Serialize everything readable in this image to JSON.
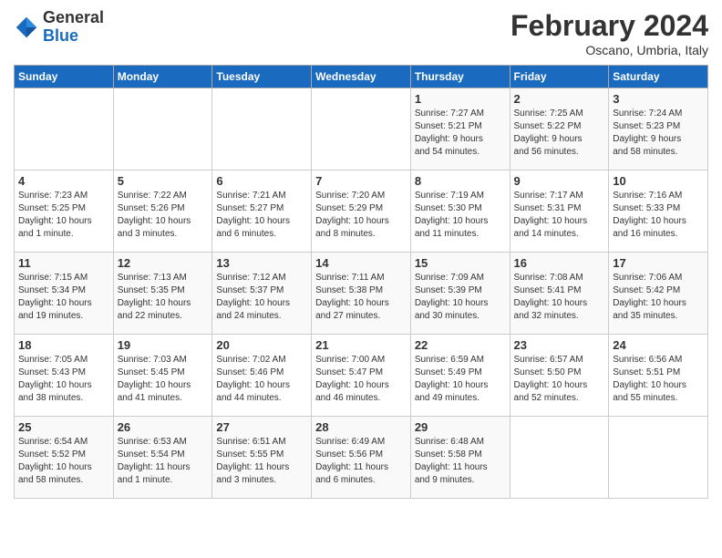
{
  "header": {
    "logo_general": "General",
    "logo_blue": "Blue",
    "month_title": "February 2024",
    "location": "Oscano, Umbria, Italy"
  },
  "days_of_week": [
    "Sunday",
    "Monday",
    "Tuesday",
    "Wednesday",
    "Thursday",
    "Friday",
    "Saturday"
  ],
  "weeks": [
    [
      {
        "num": "",
        "info": ""
      },
      {
        "num": "",
        "info": ""
      },
      {
        "num": "",
        "info": ""
      },
      {
        "num": "",
        "info": ""
      },
      {
        "num": "1",
        "info": "Sunrise: 7:27 AM\nSunset: 5:21 PM\nDaylight: 9 hours\nand 54 minutes."
      },
      {
        "num": "2",
        "info": "Sunrise: 7:25 AM\nSunset: 5:22 PM\nDaylight: 9 hours\nand 56 minutes."
      },
      {
        "num": "3",
        "info": "Sunrise: 7:24 AM\nSunset: 5:23 PM\nDaylight: 9 hours\nand 58 minutes."
      }
    ],
    [
      {
        "num": "4",
        "info": "Sunrise: 7:23 AM\nSunset: 5:25 PM\nDaylight: 10 hours\nand 1 minute."
      },
      {
        "num": "5",
        "info": "Sunrise: 7:22 AM\nSunset: 5:26 PM\nDaylight: 10 hours\nand 3 minutes."
      },
      {
        "num": "6",
        "info": "Sunrise: 7:21 AM\nSunset: 5:27 PM\nDaylight: 10 hours\nand 6 minutes."
      },
      {
        "num": "7",
        "info": "Sunrise: 7:20 AM\nSunset: 5:29 PM\nDaylight: 10 hours\nand 8 minutes."
      },
      {
        "num": "8",
        "info": "Sunrise: 7:19 AM\nSunset: 5:30 PM\nDaylight: 10 hours\nand 11 minutes."
      },
      {
        "num": "9",
        "info": "Sunrise: 7:17 AM\nSunset: 5:31 PM\nDaylight: 10 hours\nand 14 minutes."
      },
      {
        "num": "10",
        "info": "Sunrise: 7:16 AM\nSunset: 5:33 PM\nDaylight: 10 hours\nand 16 minutes."
      }
    ],
    [
      {
        "num": "11",
        "info": "Sunrise: 7:15 AM\nSunset: 5:34 PM\nDaylight: 10 hours\nand 19 minutes."
      },
      {
        "num": "12",
        "info": "Sunrise: 7:13 AM\nSunset: 5:35 PM\nDaylight: 10 hours\nand 22 minutes."
      },
      {
        "num": "13",
        "info": "Sunrise: 7:12 AM\nSunset: 5:37 PM\nDaylight: 10 hours\nand 24 minutes."
      },
      {
        "num": "14",
        "info": "Sunrise: 7:11 AM\nSunset: 5:38 PM\nDaylight: 10 hours\nand 27 minutes."
      },
      {
        "num": "15",
        "info": "Sunrise: 7:09 AM\nSunset: 5:39 PM\nDaylight: 10 hours\nand 30 minutes."
      },
      {
        "num": "16",
        "info": "Sunrise: 7:08 AM\nSunset: 5:41 PM\nDaylight: 10 hours\nand 32 minutes."
      },
      {
        "num": "17",
        "info": "Sunrise: 7:06 AM\nSunset: 5:42 PM\nDaylight: 10 hours\nand 35 minutes."
      }
    ],
    [
      {
        "num": "18",
        "info": "Sunrise: 7:05 AM\nSunset: 5:43 PM\nDaylight: 10 hours\nand 38 minutes."
      },
      {
        "num": "19",
        "info": "Sunrise: 7:03 AM\nSunset: 5:45 PM\nDaylight: 10 hours\nand 41 minutes."
      },
      {
        "num": "20",
        "info": "Sunrise: 7:02 AM\nSunset: 5:46 PM\nDaylight: 10 hours\nand 44 minutes."
      },
      {
        "num": "21",
        "info": "Sunrise: 7:00 AM\nSunset: 5:47 PM\nDaylight: 10 hours\nand 46 minutes."
      },
      {
        "num": "22",
        "info": "Sunrise: 6:59 AM\nSunset: 5:49 PM\nDaylight: 10 hours\nand 49 minutes."
      },
      {
        "num": "23",
        "info": "Sunrise: 6:57 AM\nSunset: 5:50 PM\nDaylight: 10 hours\nand 52 minutes."
      },
      {
        "num": "24",
        "info": "Sunrise: 6:56 AM\nSunset: 5:51 PM\nDaylight: 10 hours\nand 55 minutes."
      }
    ],
    [
      {
        "num": "25",
        "info": "Sunrise: 6:54 AM\nSunset: 5:52 PM\nDaylight: 10 hours\nand 58 minutes."
      },
      {
        "num": "26",
        "info": "Sunrise: 6:53 AM\nSunset: 5:54 PM\nDaylight: 11 hours\nand 1 minute."
      },
      {
        "num": "27",
        "info": "Sunrise: 6:51 AM\nSunset: 5:55 PM\nDaylight: 11 hours\nand 3 minutes."
      },
      {
        "num": "28",
        "info": "Sunrise: 6:49 AM\nSunset: 5:56 PM\nDaylight: 11 hours\nand 6 minutes."
      },
      {
        "num": "29",
        "info": "Sunrise: 6:48 AM\nSunset: 5:58 PM\nDaylight: 11 hours\nand 9 minutes."
      },
      {
        "num": "",
        "info": ""
      },
      {
        "num": "",
        "info": ""
      }
    ]
  ]
}
